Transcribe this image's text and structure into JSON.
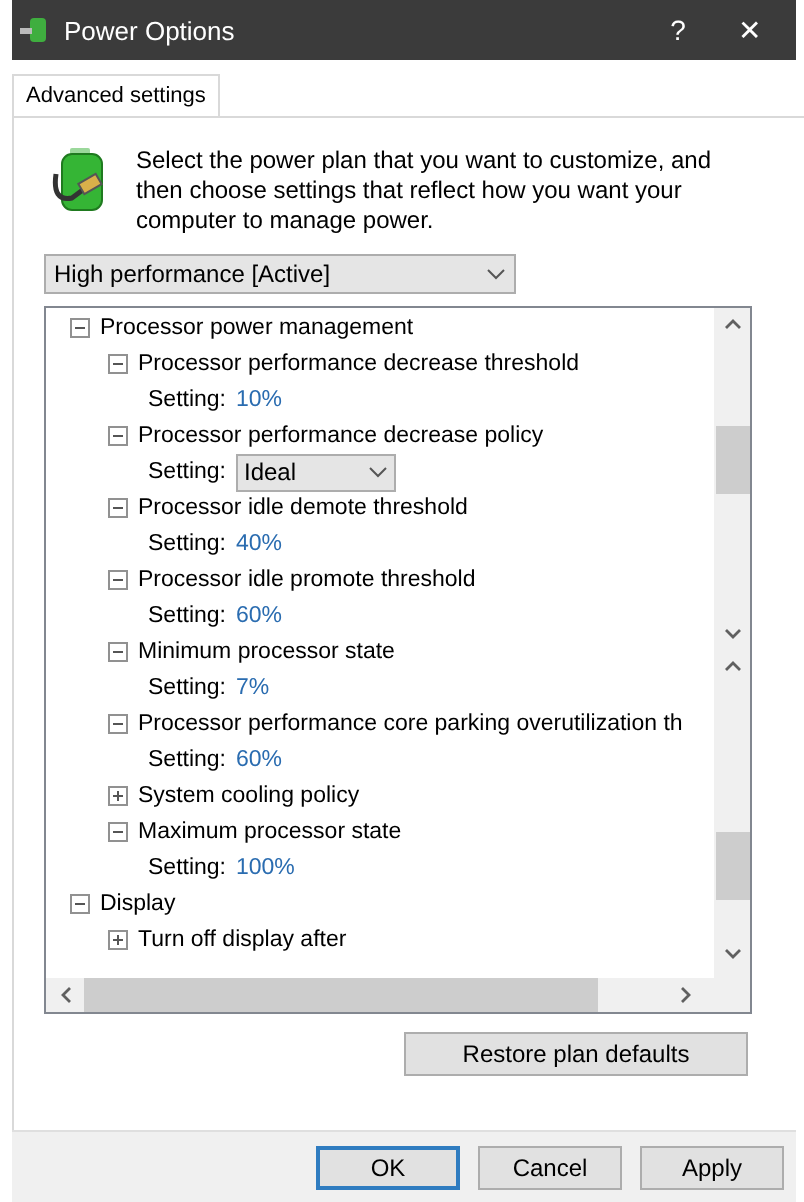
{
  "window": {
    "title": "Power Options",
    "help": "?",
    "close": "✕"
  },
  "tabs": [
    {
      "label": "Advanced settings",
      "selected": true
    }
  ],
  "intro": "Select the power plan that you want to customize, and then choose settings that reflect how you want your computer to manage power.",
  "plan": {
    "value": "High performance [Active]"
  },
  "tree": [
    {
      "label": "Processor power management",
      "expanded": true,
      "children": [
        {
          "label": "Processor performance decrease threshold",
          "expanded": true,
          "setting": {
            "kind": "text",
            "label": "Setting:",
            "value": "10%"
          }
        },
        {
          "label": "Processor performance decrease policy",
          "expanded": true,
          "setting": {
            "kind": "dropdown",
            "label": "Setting:",
            "value": "Ideal"
          }
        },
        {
          "label": "Processor idle demote threshold",
          "expanded": true,
          "setting": {
            "kind": "text",
            "label": "Setting:",
            "value": "40%"
          }
        },
        {
          "label": "Processor idle promote threshold",
          "expanded": true,
          "setting": {
            "kind": "text",
            "label": "Setting:",
            "value": "60%"
          }
        },
        {
          "label": "Minimum processor state",
          "expanded": true,
          "setting": {
            "kind": "text",
            "label": "Setting:",
            "value": "7%"
          }
        },
        {
          "label": "Processor performance core parking overutilization th",
          "expanded": true,
          "setting": {
            "kind": "text",
            "label": "Setting:",
            "value": "60%"
          }
        },
        {
          "label": "System cooling policy",
          "expanded": false
        },
        {
          "label": "Maximum processor state",
          "expanded": true,
          "setting": {
            "kind": "text",
            "label": "Setting:",
            "value": "100%"
          }
        }
      ]
    },
    {
      "label": "Display",
      "expanded": true,
      "children": [
        {
          "label": "Turn off display after",
          "expanded": false
        }
      ]
    }
  ],
  "restore_button": "Restore plan defaults",
  "buttons": [
    {
      "label": "OK",
      "default": true
    },
    {
      "label": "Cancel",
      "default": false
    },
    {
      "label": "Apply",
      "default": false
    }
  ]
}
